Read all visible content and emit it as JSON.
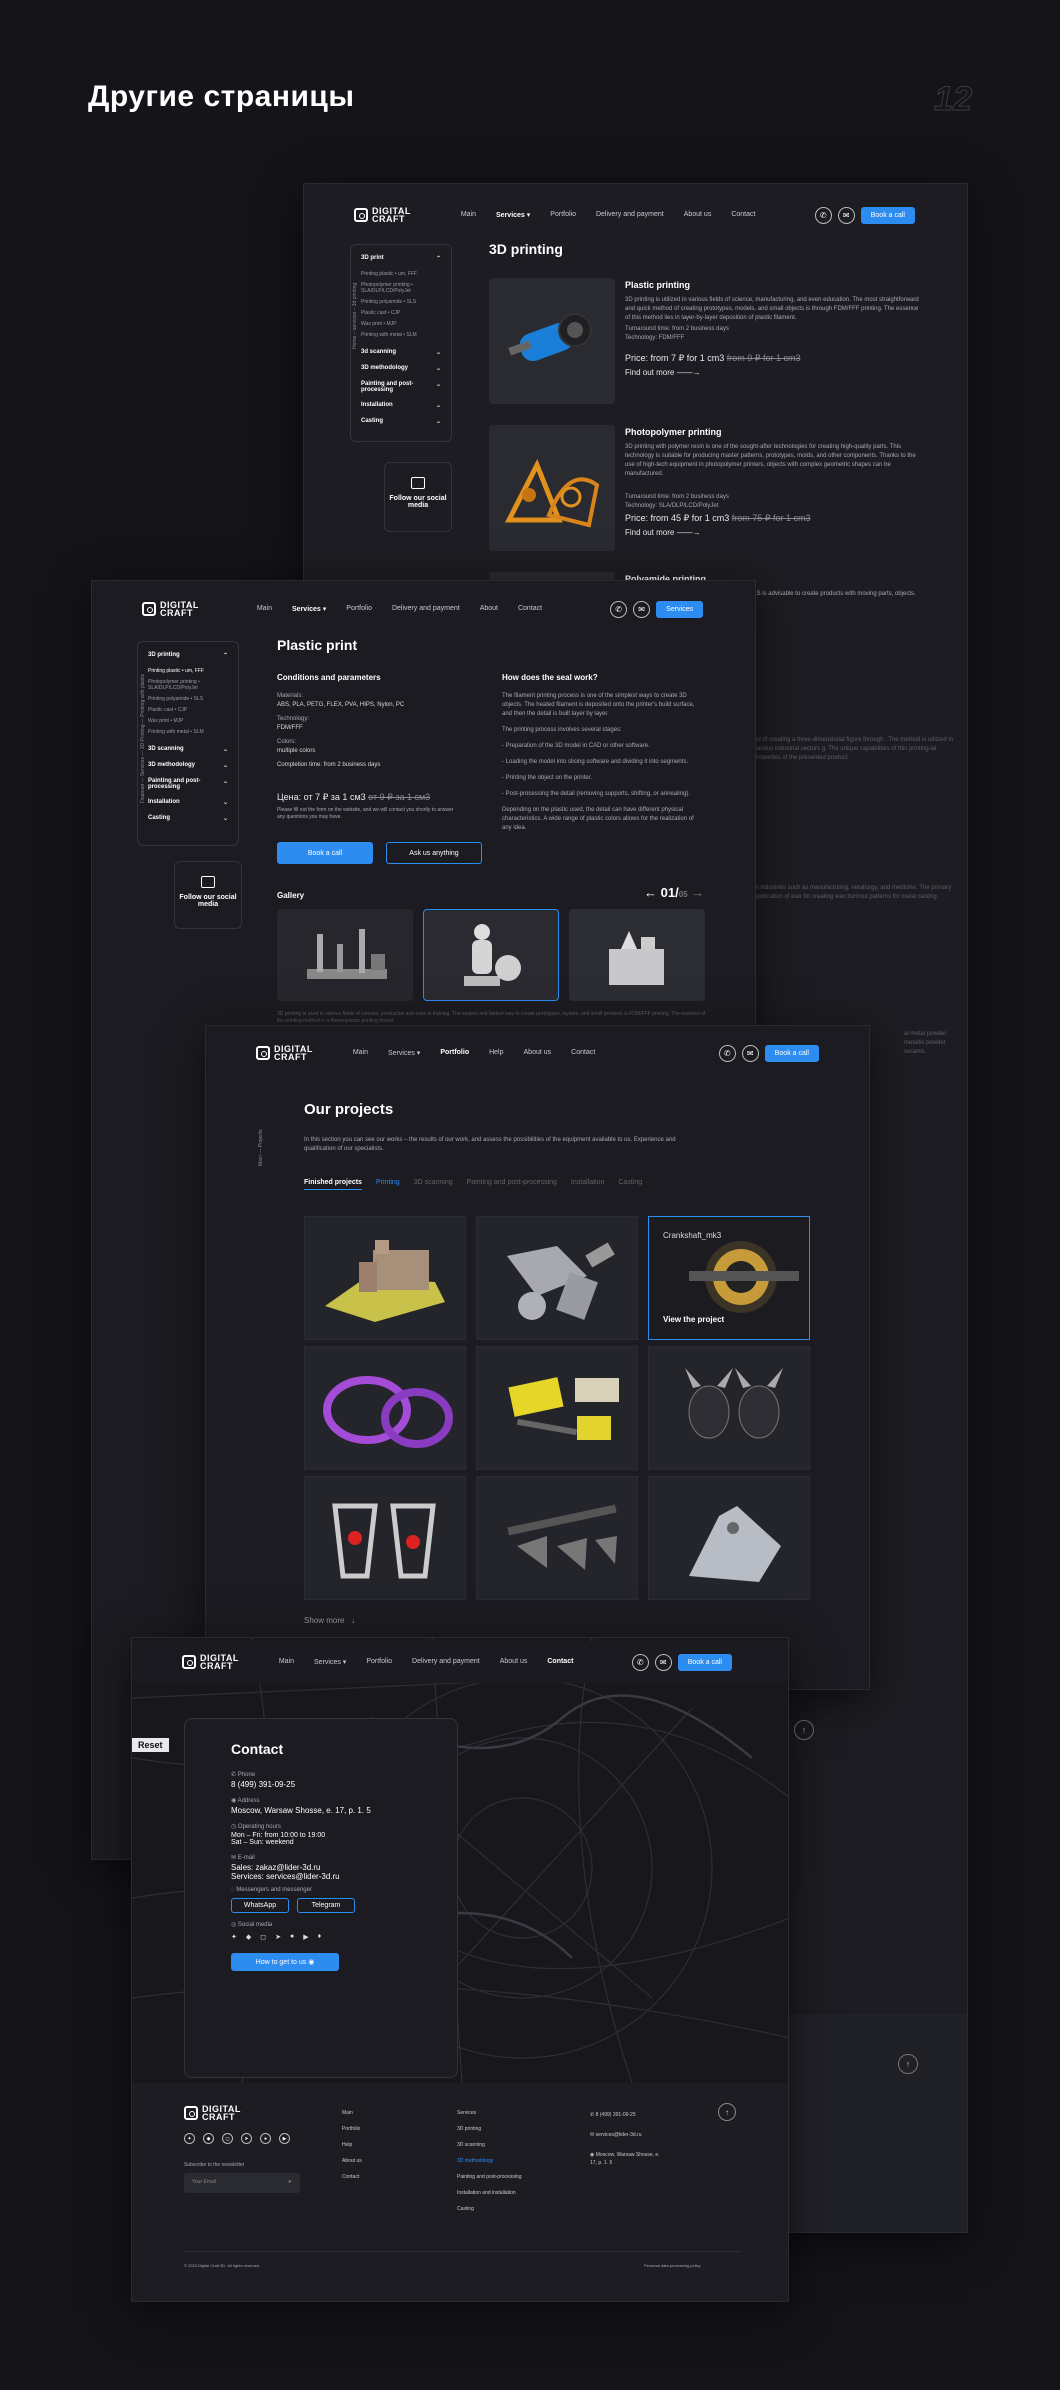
{
  "page": {
    "title": "Другие страницы",
    "number": "12"
  },
  "logo": {
    "line1": "DIGITAL",
    "line2": "CRAFT"
  },
  "frame1": {
    "nav": [
      "Main",
      "Services",
      "Portfolio",
      "Delivery and payment",
      "About us",
      "Contact"
    ],
    "book_call": "Book a call",
    "breadcrumb": "Home – services – 3d printing",
    "sidebar": {
      "print": "3D print",
      "subs": [
        "Printing plastic • um, FFF",
        "Photopolymer printing • SLA/DLP/LCD/PolyJet",
        "Printing polyamide • SLS",
        "Plastic cast • CJP",
        "Wax print • MJP",
        "Printing with metal • SLM"
      ],
      "items": [
        "3d scanning",
        "3D methodology",
        "Painting and post-processing",
        "Installation",
        "Casting"
      ]
    },
    "follow": "Follow our social media",
    "title": "3D printing",
    "products": [
      {
        "name": "Plastic printing",
        "desc": "3D printing is utilized in various fields of science, manufacturing, and even education. The most straightforward and quick method of creating prototypes, models, and small objects is through FDM/FFF printing. The essence of this method lies in layer-by-layer deposition of plastic filament.",
        "turn": "Turnaround time: from 2 business days",
        "tech": "Technology: FDM/FFF",
        "price": "Price: from 7 ₽ for 1 cm3",
        "old": "from 9 ₽ for 1 cm3",
        "more": "Find out more"
      },
      {
        "name": "Photopolymer printing",
        "desc": "3D printing with polymer resin is one of the sought-after technologies for creating high-quality parts. This technology is suitable for producing master patterns, prototypes, molds, and other components. Thanks to the use of high-tech equipment in photopolymer printers, objects with complex geometric shapes can be manufactured.",
        "turn": "Turnaround time: from 2 business days",
        "tech": "Technology: SLA/DLP/LCD/PolyJet",
        "price": "Price: from 45 ₽ for 1 cm3",
        "old": "from 75 ₽ for 1 cm3",
        "more": "Find out more"
      },
      {
        "name": "Polyamide printing",
        "desc": "with complex geometry. Using 3D printing with SLS is advisable to create products with moving parts, objects."
      }
    ],
    "bg_texts": [
      "od of creating a three-dimensional figure through . The method is utilized in various industrial sectors g. The unique capabilities of this printing ial properties of the presented product.",
      "in industries such as manufacturing, netallurgy, and medicine. The primary application of wax for creating wax burnout patterns for metal casting.",
      "al metal powder. metallic powder ceramic."
    ]
  },
  "frame2": {
    "nav": [
      "Main",
      "Services",
      "Portfolio",
      "Delivery and payment",
      "About",
      "Contact"
    ],
    "button": "Services",
    "breadcrumb": "Главная — Services — 3D Printing — Printing with plastic",
    "sidebar": {
      "print": "3D printing",
      "subs": [
        "Printing plastic • um, FFF",
        "Photopolymer printing • SLA/DLP/LCD/PolyJet",
        "Printing polyamide • SLS",
        "Plastic cast • CJP",
        "Wax print • MJP",
        "Printing with metal • SLM"
      ],
      "items": [
        "3D scanning",
        "3D methodology",
        "Painting and post-processing",
        "Installation",
        "Casting"
      ]
    },
    "follow": "Follow our social media",
    "title": "Plastic print",
    "cond_title": "Conditions and parameters",
    "materials_label": "Materials:",
    "materials": "ABS, PLA, PETG, FLEX, PVA, HIPS, Nylon, PC",
    "tech_label": "Technology:",
    "tech": "FDM/FFF",
    "colors_label": "Colors:",
    "colors": "multiple colors",
    "completion": "Completion time: from 2 business days",
    "price": "Цена: от 7 ₽ за 1 см3",
    "old": "от 9 ₽ за 1 см3",
    "note": "Please fill out the form on the website, and we will contact you shortly to answer any questions you may have.",
    "book": "Book a call",
    "ask": "Ask us anything",
    "how_title": "How does the seal work?",
    "how_p1": "The filament printing process is one of the simplest ways to create 3D objects. The heated filament is deposited onto the printer's build surface, and then the detail is built layer by layer.",
    "how_p2": "The printing process involves several stages:",
    "how_steps": [
      "- Preparation of the 3D model in CAD or other software.",
      "- Loading the model into slicing software and dividing it into segments.",
      "- Printing the object on the printer.",
      "- Post-processing the detail (removing supports, shifting, or annealing)."
    ],
    "how_p3": "Depending on the plastic used, the detail can have different physical characteristics. A wide range of plastic colors allows for the realization of any idea.",
    "gallery": "Gallery",
    "counter": "01/",
    "counter_total": "05",
    "footer_text": "3D printing is used in various fields of science, production and even in training. The easiest and fastest way to create prototypes, layouts, and small products is FDM/FFF printing. The essence of the printing method is a thermoplastic printing thread."
  },
  "frame3": {
    "nav": [
      "Main",
      "Services",
      "Portfolio",
      "Help",
      "About us",
      "Contact"
    ],
    "book": "Book a call",
    "breadcrumb": "Main — Projects",
    "title": "Our projects",
    "intro": "In this section you can see our works – the results of our work, and assess the possibilities of the equipment available to us. Experience and qualification of our specialists.",
    "tabs": [
      "Finished projects",
      "Printing",
      "3D scanning",
      "Painting and post-processing",
      "Installation",
      "Casting"
    ],
    "hover_title": "Crankshaft_mk3",
    "hover_link": "View the project",
    "more": "Show more"
  },
  "frame4": {
    "nav": [
      "Main",
      "Services",
      "Portfolio",
      "Delivery and payment",
      "About us",
      "Contact"
    ],
    "book": "Book a call",
    "reset": "Reset",
    "contact_title": "Contact",
    "phone_label": "Phone",
    "phone": "8 (499) 391-09-25",
    "address_label": "Address",
    "address": "Moscow, Warsaw Shosse, e. 17, p. 1. 5",
    "hours_label": "Operating hours",
    "hours1": "Mon – Fri: from 10:00 to 19:00",
    "hours2": "Sat – Sun: weekend",
    "email_label": "E-mail",
    "sales": "Sales: zakaz@lider-3d.ru",
    "services_mail": "Services: services@lider-3d.ru",
    "messengers_label": "Messengers and messenger",
    "whatsapp": "WhatsApp",
    "telegram": "Telegram",
    "social_label": "Social media",
    "how_get": "How to get to us"
  },
  "footer": {
    "col1": [
      "Main",
      "Portfolio",
      "Help",
      "About us",
      "Contact"
    ],
    "col2_title": "Services",
    "col2": [
      "3D printing",
      "3D scanning",
      "3D methodology",
      "Painting and post-processing",
      "Installation and installation",
      "Casting"
    ],
    "contacts": [
      "8 (499) 391-09-25",
      "services@lider-3d.ru",
      "Moscow, Warsaw Shosse, e. 17, p. 1. 5"
    ],
    "subscribe": "Subscribe to the newsletter",
    "email_placeholder": "Your Email",
    "copyright": "© 2023 Digital Craft 3D. All rights reserved.",
    "policy": "Personal data processing policy"
  }
}
